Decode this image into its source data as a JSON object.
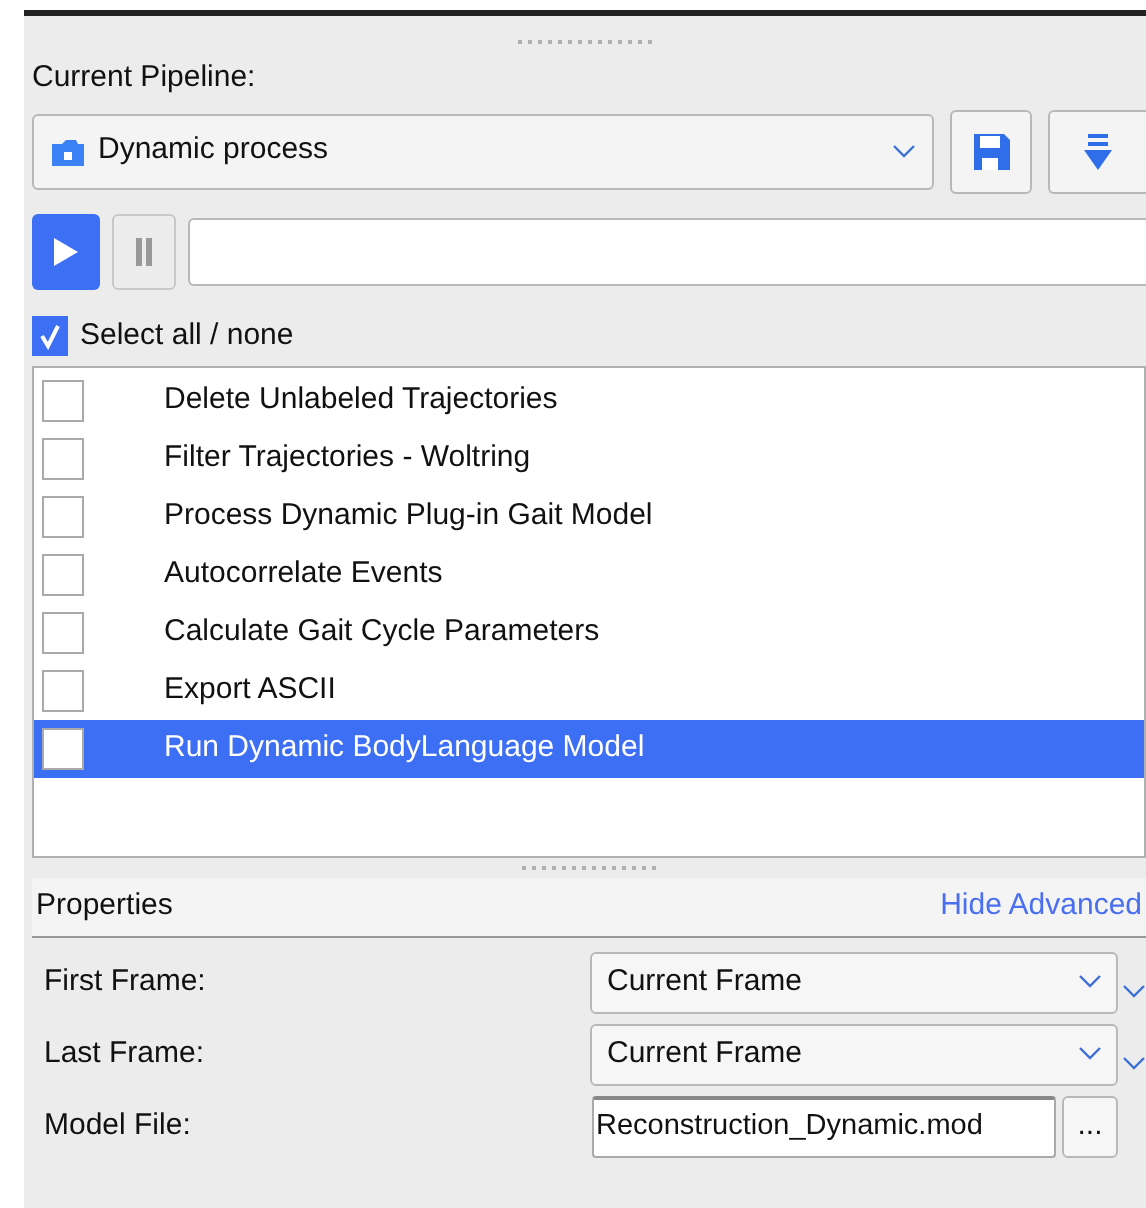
{
  "pipeline": {
    "label": "Current Pipeline:",
    "value": "Dynamic process"
  },
  "select_all": {
    "label": "Select all / none",
    "checked": true
  },
  "operations": [
    {
      "label": "Delete Unlabeled Trajectories",
      "checked": false,
      "selected": false
    },
    {
      "label": "Filter Trajectories - Woltring",
      "checked": false,
      "selected": false
    },
    {
      "label": "Process Dynamic Plug-in Gait Model",
      "checked": false,
      "selected": false
    },
    {
      "label": "Autocorrelate Events",
      "checked": false,
      "selected": false
    },
    {
      "label": "Calculate Gait Cycle Parameters",
      "checked": false,
      "selected": false
    },
    {
      "label": "Export ASCII",
      "checked": false,
      "selected": false
    },
    {
      "label": "Run Dynamic BodyLanguage Model",
      "checked": false,
      "selected": true
    }
  ],
  "properties": {
    "title": "Properties",
    "toggle_link": "Hide Advanced",
    "rows": [
      {
        "label": "First Frame:",
        "kind": "dropdown",
        "value": "Current Frame"
      },
      {
        "label": "Last Frame:",
        "kind": "dropdown",
        "value": "Current Frame"
      },
      {
        "label": "Model File:",
        "kind": "file",
        "value": "Reconstruction_Dynamic.mod",
        "button": "..."
      }
    ]
  }
}
